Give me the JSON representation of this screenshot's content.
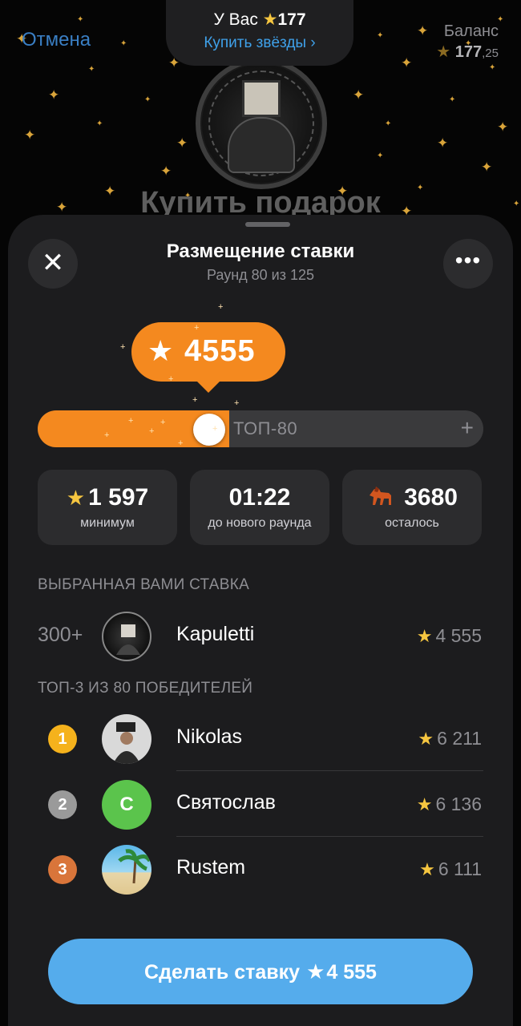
{
  "background": {
    "cancel_label": "Отмена",
    "balance_label": "Баланс",
    "balance_amount": "177",
    "balance_fraction": ",25",
    "title": "Купить подарок",
    "stars_pill": {
      "prefix": "У Вас",
      "amount": "177",
      "buy_link": "Купить звёзды"
    }
  },
  "sheet": {
    "title": "Размещение ставки",
    "subtitle": "Раунд 80 из 125",
    "bid_bubble": "4555",
    "slider": {
      "label": "ТОП-80",
      "fill_fraction": 0.43
    },
    "stats": [
      {
        "icon": "star-icon",
        "value": "1 597",
        "label": "минимум"
      },
      {
        "icon": "",
        "value": "01:22",
        "label": "до нового раунда"
      },
      {
        "icon": "horse-icon",
        "value": "3680",
        "label": "осталось"
      }
    ],
    "your_bid_header": "ВЫБРАННАЯ ВАМИ СТАВКА",
    "your_bid": {
      "rank": "300+",
      "name": "Kapuletti",
      "amount": "4 555"
    },
    "top_header": "ТОП-3 ИЗ 80 ПОБЕДИТЕЛЕЙ",
    "top": [
      {
        "rank": "1",
        "name": "Nikolas",
        "amount": "6 211",
        "medal_color": "#f5b21c"
      },
      {
        "rank": "2",
        "name": "Святослав",
        "amount": "6 136",
        "medal_color": "#9a9a9a",
        "avatar_letter": "C",
        "avatar_color": "#5bc44c"
      },
      {
        "rank": "3",
        "name": "Rustem",
        "amount": "6 111",
        "medal_color": "#d9753a"
      }
    ],
    "cta_label": "Сделать ставку",
    "cta_amount": "4 555"
  },
  "colors": {
    "accent_orange": "#f4891f",
    "button_blue": "#55acec",
    "star_gold": "#f6c640"
  }
}
